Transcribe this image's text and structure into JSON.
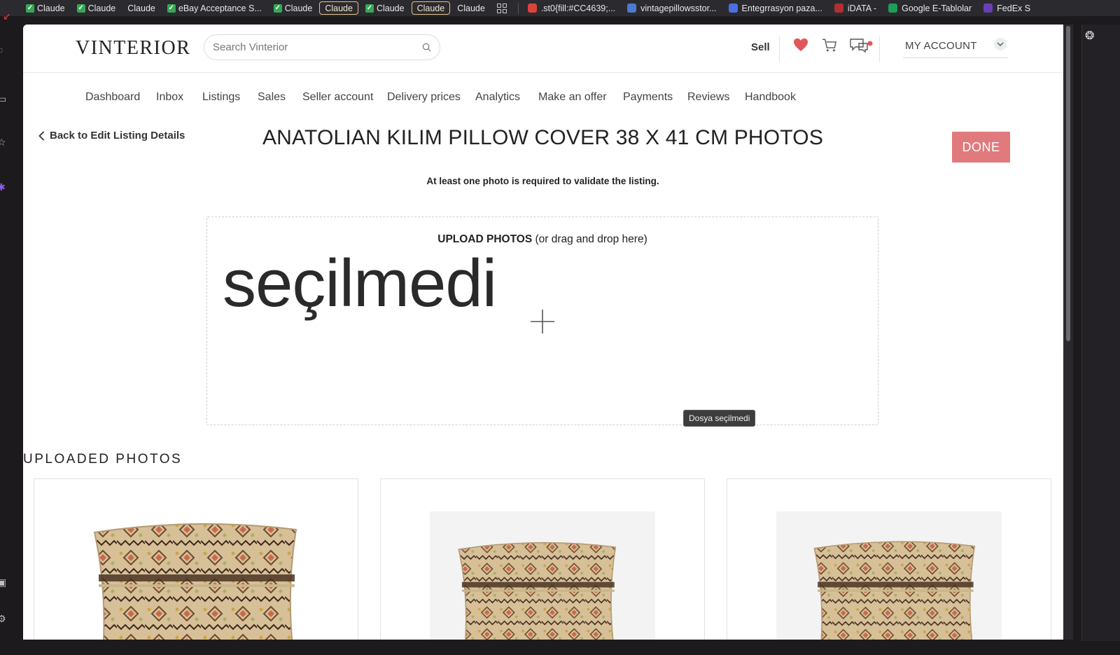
{
  "bookmarks": [
    {
      "label": "Claude",
      "type": "check"
    },
    {
      "label": "Claude",
      "type": "check"
    },
    {
      "label": "Claude",
      "type": "plain"
    },
    {
      "label": "eBay Acceptance S...",
      "type": "check"
    },
    {
      "label": "Claude",
      "type": "check"
    },
    {
      "label": "Claude",
      "type": "boxed"
    },
    {
      "label": "Claude",
      "type": "check"
    },
    {
      "label": "Claude",
      "type": "boxed"
    },
    {
      "label": "Claude",
      "type": "plain"
    },
    {
      "label": ".st0{fill:#CC4639;...",
      "type": "fav",
      "color": "#d8443a"
    },
    {
      "label": "vintagepillowsstor...",
      "type": "fav",
      "color": "#4a7bd3"
    },
    {
      "label": "Entegrrasyon paza...",
      "type": "fav",
      "color": "#4a6fe0"
    },
    {
      "label": "iDATA -",
      "type": "fav",
      "color": "#b03030"
    },
    {
      "label": "Google E-Tablolar",
      "type": "fav",
      "color": "#1e9d56"
    },
    {
      "label": "FedEx S",
      "type": "fav",
      "color": "#6a3fb5"
    }
  ],
  "header": {
    "logo": "VINTERIOR",
    "search_placeholder": "Search Vinterior",
    "sell": "Sell",
    "account": "MY ACCOUNT"
  },
  "nav": [
    "Dashboard",
    "Inbox",
    "Listings",
    "Sales",
    "Seller account",
    "Delivery prices",
    "Analytics",
    "Make an offer",
    "Payments",
    "Reviews",
    "Handbook"
  ],
  "page": {
    "back": "Back to Edit Listing Details",
    "title": "ANATOLIAN KILIM PILLOW COVER 38 X 41 CM PHOTOS",
    "done": "DONE",
    "note": "At least one photo is required to validate the listing."
  },
  "upload": {
    "title_bold": "UPLOAD PHOTOS",
    "title_rest": " (or drag and drop here)",
    "file_status_big": "seçilmedi",
    "tooltip": "Dosya seçilmedi"
  },
  "uploaded": {
    "title": "UPLOADED PHOTOS"
  },
  "colors": {
    "done": "#e07a7d",
    "heart": "#e0575b",
    "chat_dot": "#e0575b"
  }
}
